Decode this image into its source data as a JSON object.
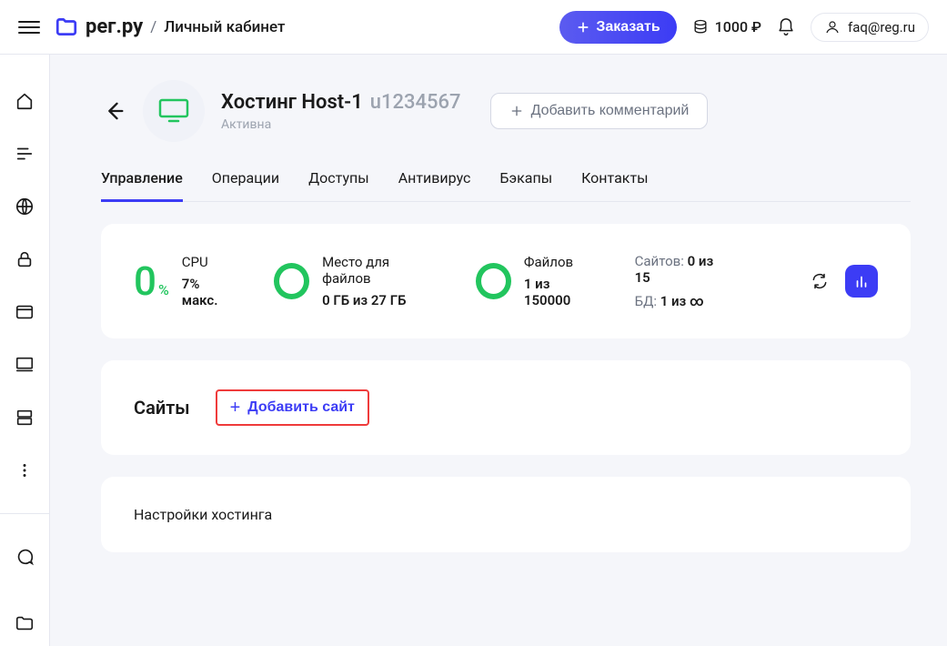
{
  "header": {
    "logo_text": "рег.ру",
    "logo_sub": "Личный кабинет",
    "order_label": "Заказать",
    "balance": "1000 ₽",
    "account": "faq@reg.ru"
  },
  "page": {
    "title": "Хостинг Host-1",
    "title_id": "u1234567",
    "status": "Активна",
    "comment_label": "Добавить комментарий"
  },
  "tabs": [
    "Управление",
    "Операции",
    "Доступы",
    "Антивирус",
    "Бэкапы",
    "Контакты"
  ],
  "stats": {
    "cpu_value": "0",
    "cpu_pct": "%",
    "cpu_label": "CPU",
    "cpu_sub": "7% макс.",
    "storage_label": "Место для файлов",
    "storage_value": "0 ГБ из 27 ГБ",
    "files_label": "Файлов",
    "files_value": "1 из 150000",
    "sites_label": "Сайтов:",
    "sites_value": "0 из 15",
    "db_label": "БД:",
    "db_value": "1 из ∞"
  },
  "sites": {
    "title": "Сайты",
    "add_label": "Добавить сайт"
  },
  "settings": {
    "title": "Настройки хостинга"
  }
}
